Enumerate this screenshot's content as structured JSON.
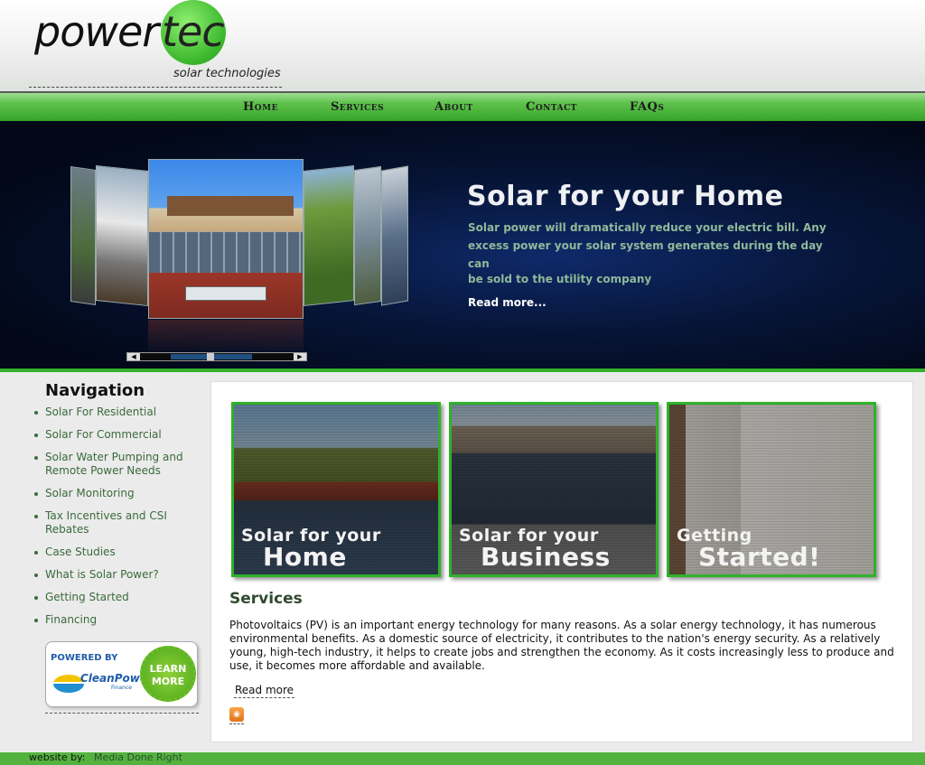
{
  "logo": {
    "word1": "power",
    "word2": "tec",
    "subtitle": "solar technologies"
  },
  "nav": [
    {
      "label": "Home"
    },
    {
      "label": "Services"
    },
    {
      "label": "About"
    },
    {
      "label": "Contact"
    },
    {
      "label": "FAQs"
    }
  ],
  "hero": {
    "title": "Solar for your Home",
    "text": "Solar power will dramatically reduce your electric bill. Any excess power your solar system generates during the day can",
    "text2": "be sold to the utility company",
    "read_more": "Read more..."
  },
  "sidebar": {
    "title": "Navigation",
    "items": [
      {
        "label": "Solar For Residential"
      },
      {
        "label": "Solar For Commercial"
      },
      {
        "label": "Solar Water Pumping and Remote Power Needs"
      },
      {
        "label": "Solar Monitoring"
      },
      {
        "label": "Tax Incentives and CSI Rebates"
      },
      {
        "label": "Case Studies"
      },
      {
        "label": "What is Solar Power?"
      },
      {
        "label": "Getting Started"
      },
      {
        "label": "Financing"
      }
    ],
    "banner": {
      "powered_by": "POWERED BY",
      "brand": "CleanPower",
      "brand_sub": "Finance",
      "cta1": "LEARN",
      "cta2": "MORE"
    }
  },
  "tiles": [
    {
      "line1": "Solar for your",
      "line2": "Home"
    },
    {
      "line1": "Solar for your",
      "line2": "Business"
    },
    {
      "line1": "Getting",
      "line2": "Started!"
    }
  ],
  "services": {
    "title": "Services",
    "text": "Photovoltaics (PV) is an important energy technology for many reasons. As a solar energy technology, it has numerous environmental benefits. As a domestic source of electricity, it contributes to the nation's energy security. As a relatively young, high-tech industry, it helps to create jobs and strengthen the economy. As it costs increasingly less to produce and use, it becomes more affordable and available.",
    "read_more": "Read more"
  },
  "footer": {
    "by_label": "website by:",
    "link": "Media Done Right"
  },
  "colors": {
    "accent_green": "#34b02a",
    "hero_bg": "#061436"
  }
}
